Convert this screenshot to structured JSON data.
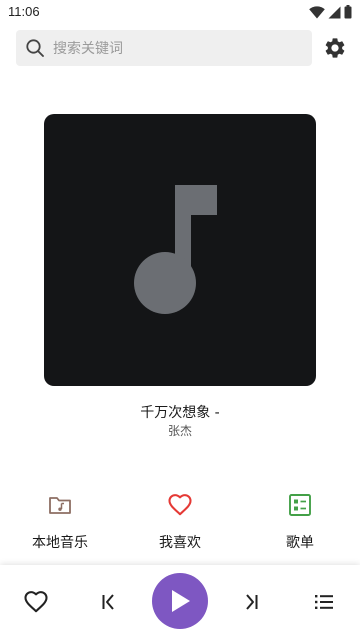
{
  "status_bar": {
    "time": "11:06",
    "icons": [
      "wifi-icon",
      "cellular-signal-icon",
      "battery-icon"
    ]
  },
  "search": {
    "placeholder": "搜索关键词",
    "icon": "search-icon"
  },
  "settings": {
    "icon": "gear-icon"
  },
  "album_art": {
    "icon": "music-note-icon",
    "background": "#141517",
    "icon_color": "#6b6e73"
  },
  "now_playing": {
    "title": "千万次想象 -",
    "artist": "张杰"
  },
  "nav": [
    {
      "label": "本地音乐",
      "icon": "local-music-folder-icon",
      "color": "#8d6e63"
    },
    {
      "label": "我喜欢",
      "icon": "heart-icon",
      "color": "#e53935"
    },
    {
      "label": "歌单",
      "icon": "playlist-icon",
      "color": "#43a047"
    }
  ],
  "player": {
    "like_icon": "heart-outline-icon",
    "prev_icon": "skip-previous-icon",
    "play_icon": "play-icon",
    "next_icon": "skip-next-icon",
    "queue_icon": "queue-list-icon",
    "accent": "#7e57c2"
  }
}
